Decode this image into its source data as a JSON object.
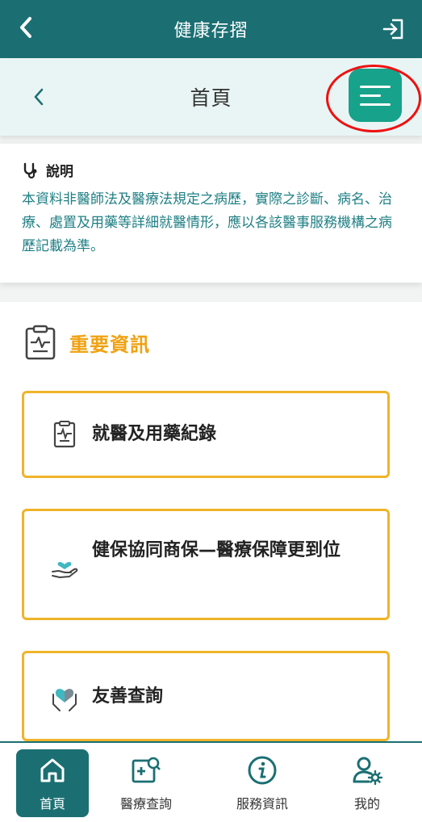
{
  "topbar": {
    "title": "健康存摺",
    "back_icon": "chevron-left-icon",
    "logout_icon": "logout-icon"
  },
  "subheader": {
    "title": "首頁",
    "back_icon": "chevron-left-icon",
    "menu_icon": "hamburger-menu-icon"
  },
  "notice": {
    "heading": "說明",
    "icon": "stethoscope-icon",
    "body": "本資料非醫師法及醫療法規定之病歷，實際之診斷、病名、治療、處置及用藥等詳細就醫情形，應以各該醫事服務機構之病歷記載為準。"
  },
  "section": {
    "title": "重要資訊",
    "icon": "clipboard-pulse-icon"
  },
  "cards": [
    {
      "label": "就醫及用藥紀錄",
      "icon": "clipboard-pulse-icon"
    },
    {
      "label": "健保協同商保—醫療保障更到位",
      "icon": "heart-hand-icon"
    },
    {
      "label": "友善查詢",
      "icon": "heart-hands-icon"
    }
  ],
  "bottom_nav": [
    {
      "label": "首頁",
      "icon": "home-icon",
      "active": true
    },
    {
      "label": "醫療查詢",
      "icon": "medical-search-icon",
      "active": false
    },
    {
      "label": "服務資訊",
      "icon": "info-icon",
      "active": false
    },
    {
      "label": "我的",
      "icon": "user-settings-icon",
      "active": false
    }
  ],
  "colors": {
    "primary": "#1b6f73",
    "accent": "#17a38b",
    "orange": "#f0a212",
    "card_border": "#f0b429",
    "highlight": "#e11111"
  }
}
